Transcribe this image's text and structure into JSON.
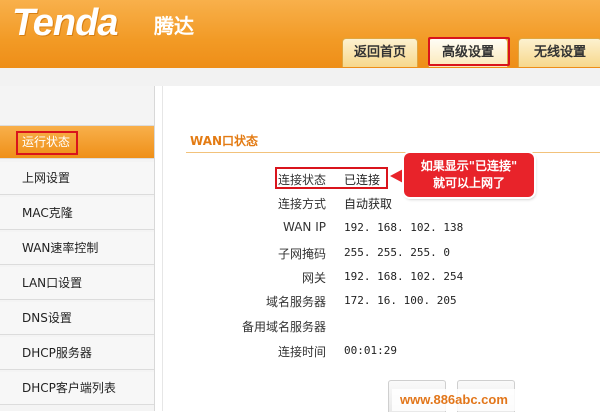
{
  "header": {
    "logo_text": "Tenda",
    "logo_cn": "腾达",
    "tabs": [
      {
        "label": "返回首页"
      },
      {
        "label": "高级设置"
      },
      {
        "label": "无线设置"
      }
    ]
  },
  "sidebar": {
    "items": [
      {
        "label": "运行状态"
      },
      {
        "label": "上网设置"
      },
      {
        "label": "MAC克隆"
      },
      {
        "label": "WAN速率控制"
      },
      {
        "label": "LAN口设置"
      },
      {
        "label": "DNS设置"
      },
      {
        "label": "DHCP服务器"
      },
      {
        "label": "DHCP客户端列表"
      }
    ]
  },
  "main": {
    "section_title": "WAN口状态",
    "rows": [
      {
        "label": "连接状态",
        "value": "已连接"
      },
      {
        "label": "连接方式",
        "value": "自动获取"
      },
      {
        "label": "WAN IP",
        "value": "192. 168. 102. 138"
      },
      {
        "label": "子网掩码",
        "value": "255. 255. 255. 0"
      },
      {
        "label": "网关",
        "value": "192. 168. 102. 254"
      },
      {
        "label": "域名服务器",
        "value": "172. 16. 100. 205"
      },
      {
        "label": "备用域名服务器",
        "value": ""
      },
      {
        "label": "连接时间",
        "value": "00:01:29"
      }
    ]
  },
  "callout": {
    "line1": "如果显示\"已连接\"",
    "line2": "就可以上网了"
  },
  "watermark": "www.886abc.com",
  "colors": {
    "brand_orange": "#f29a25",
    "highlight_red": "#d9141c",
    "callout_red": "#e8232a"
  }
}
